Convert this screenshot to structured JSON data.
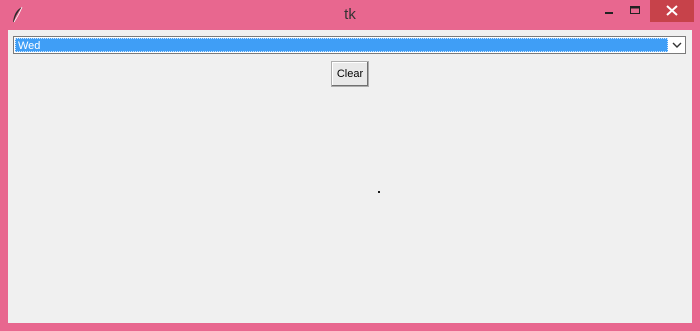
{
  "window": {
    "title": "tk",
    "icon": "feather-icon",
    "frame_color": "#e8678f",
    "close_button_color": "#c7424a"
  },
  "combobox": {
    "value": "Wed",
    "selection_color": "#3f9ef6"
  },
  "buttons": {
    "clear_label": "Clear"
  }
}
